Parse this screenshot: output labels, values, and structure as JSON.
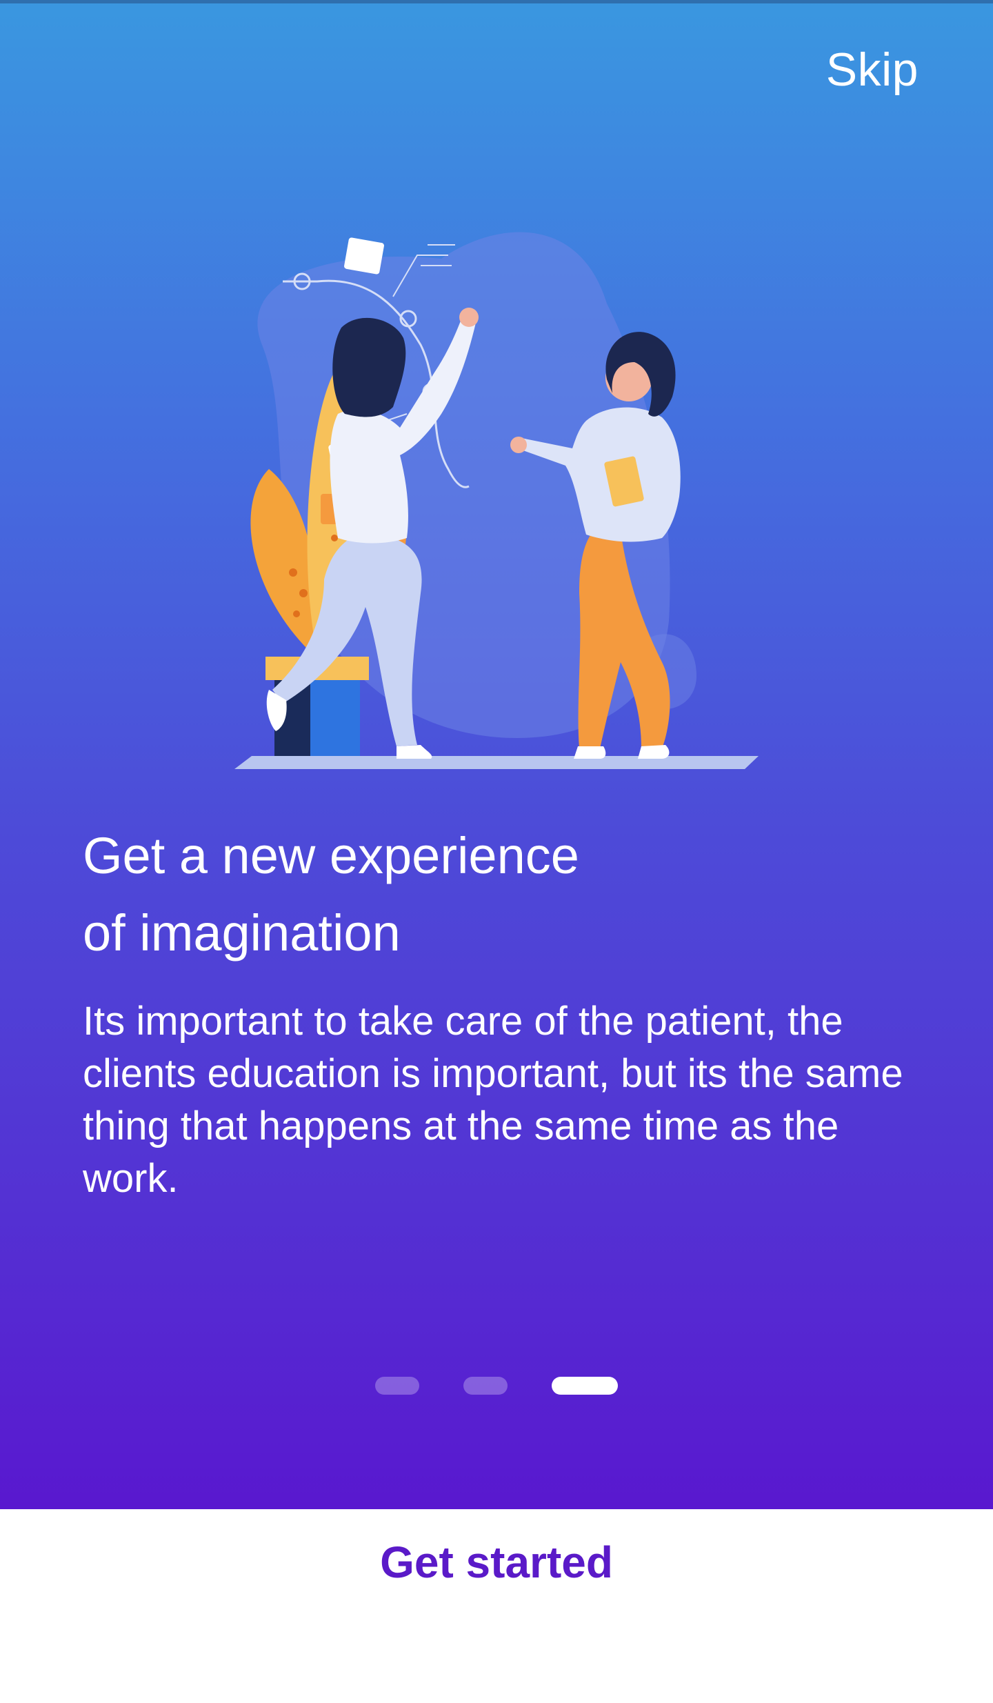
{
  "header": {
    "skip_label": "Skip"
  },
  "illustration": {
    "icon": "collaboration-illustration"
  },
  "content": {
    "title_line1": "Get a new experience",
    "title_line2": "of imagination",
    "description": "Its important to take care of the patient, the clients education is important, but its the same thing that happens at the same time as the work."
  },
  "pager": {
    "total_pages": 3,
    "current_page": 3
  },
  "footer": {
    "cta_label": "Get started"
  },
  "colors": {
    "gradient_top": "#3a97e0",
    "gradient_bottom": "#5918cf",
    "cta_text": "#5a1ac8"
  }
}
